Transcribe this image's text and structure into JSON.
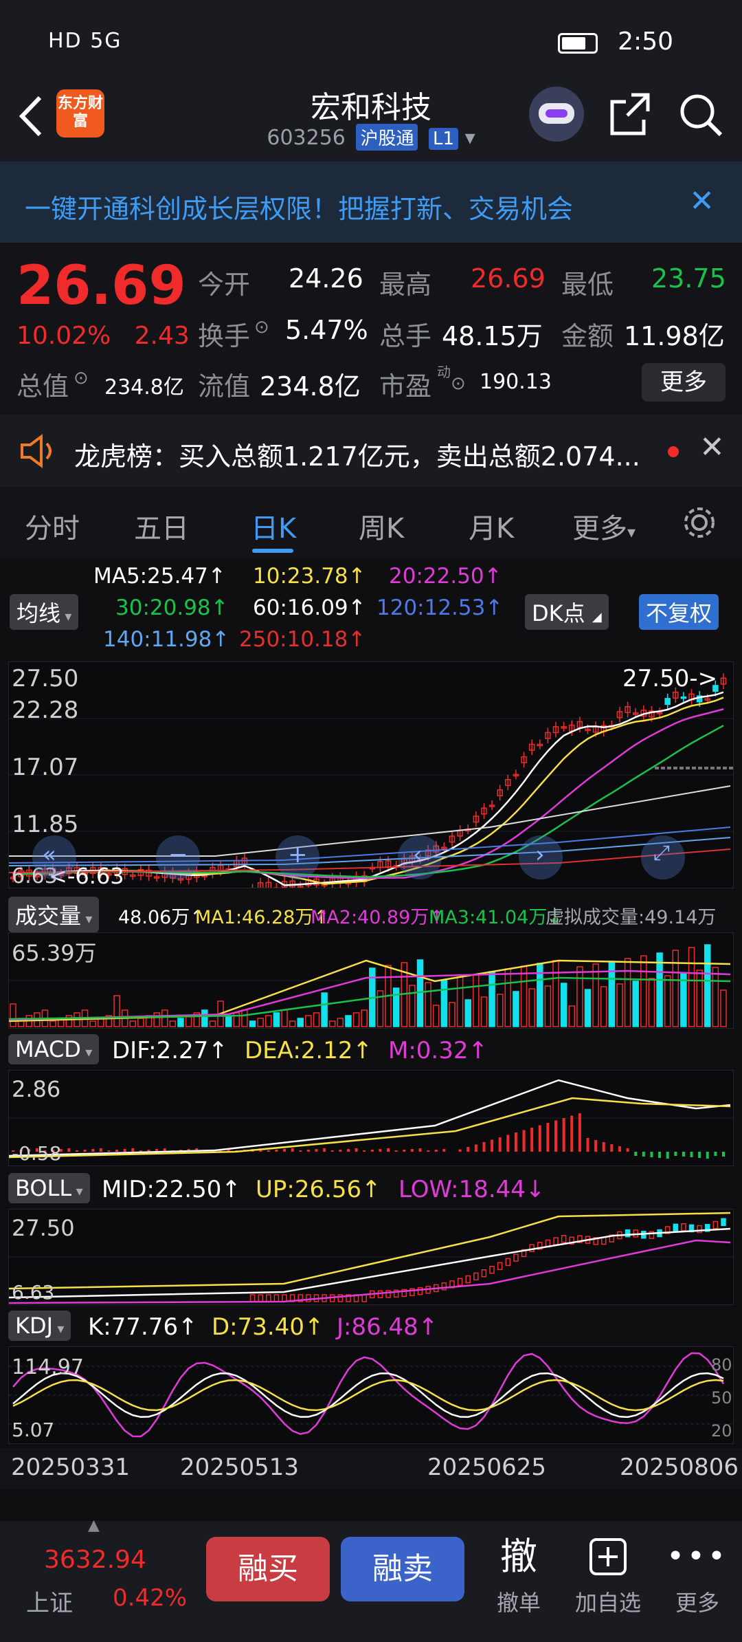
{
  "status_bar": {
    "left": "HD 5G",
    "time": "2:50"
  },
  "header": {
    "title": "宏和科技",
    "code": "603256",
    "tag1": "沪股通",
    "tag2": "L1",
    "logo": "东方财富"
  },
  "banner": {
    "text": "一键开通科创成长层权限！把握打新、交易机会"
  },
  "quote": {
    "price": "26.69",
    "pct": "10.02%",
    "change": "2.43",
    "open_label": "今开",
    "open": "24.26",
    "high_label": "最高",
    "high": "26.69",
    "low_label": "最低",
    "low": "23.75",
    "turnover_label": "换手",
    "turnover": "5.47%",
    "volume_label": "总手",
    "volume": "48.15万",
    "amount_label": "金额",
    "amount": "11.98亿",
    "mktcap_label": "总值",
    "mktcap": "234.8亿",
    "float_label": "流值",
    "float": "234.8亿",
    "pe_label": "市盈",
    "pe_sup": "动",
    "pe": "190.13",
    "more": "更多"
  },
  "news": {
    "text": "龙虎榜：买入总额1.217亿元，卖出总额2.074..."
  },
  "tabs": [
    "分时",
    "五日",
    "日K",
    "周K",
    "月K",
    "更多"
  ],
  "ma_header": {
    "btn": "均线",
    "ma5": "MA5:25.47",
    "ma10": "10:23.78",
    "ma20": "20:22.50",
    "ma30": "30:20.98",
    "ma60": "60:16.09",
    "ma120": "120:12.53",
    "ma140": "140:11.98",
    "ma250": "250:10.18",
    "dk": "DK点",
    "fq": "不复权"
  },
  "kline": {
    "ticks": [
      "27.50",
      "22.28",
      "17.07",
      "11.85",
      "6.63"
    ],
    "max_label": "27.50->",
    "min_label": "6.63"
  },
  "volume": {
    "btn": "成交量",
    "v": "48.06万",
    "ma1": "MA1:46.28万",
    "ma2": "MA2:40.89万",
    "ma3": "MA3:41.04万",
    "virtual": "虚拟成交量:49.14万",
    "tick": "65.39万"
  },
  "macd": {
    "btn": "MACD",
    "dif": "DIF:2.27",
    "dea": "DEA:2.12",
    "m": "M:0.32",
    "top": "2.86",
    "bottom": "-0.58"
  },
  "boll": {
    "btn": "BOLL",
    "mid": "MID:22.50",
    "up": "UP:26.56",
    "low": "LOW:18.44",
    "top": "27.50",
    "bottom": "6.63"
  },
  "kdj": {
    "btn": "KDJ",
    "k": "K:77.76",
    "d": "D:73.40",
    "j": "J:86.48",
    "top": "114.97",
    "bottom": "5.07",
    "r80": "80",
    "r50": "50",
    "r20": "20"
  },
  "dates": [
    "20250331",
    "20250513",
    "20250625",
    "20250806"
  ],
  "bottom_bar": {
    "index_value": "3632.94",
    "index_name": "上证",
    "index_pct": "0.42%",
    "buy": "融买",
    "sell": "融卖",
    "cancel_icon_text": "撤",
    "cancel": "撤单",
    "add": "加自选",
    "more": "更多"
  },
  "colors": {
    "up": "#f02b2b",
    "down": "#19c24b",
    "accent": "#3f9cf5",
    "cyan_candle": "#13e0ea"
  }
}
